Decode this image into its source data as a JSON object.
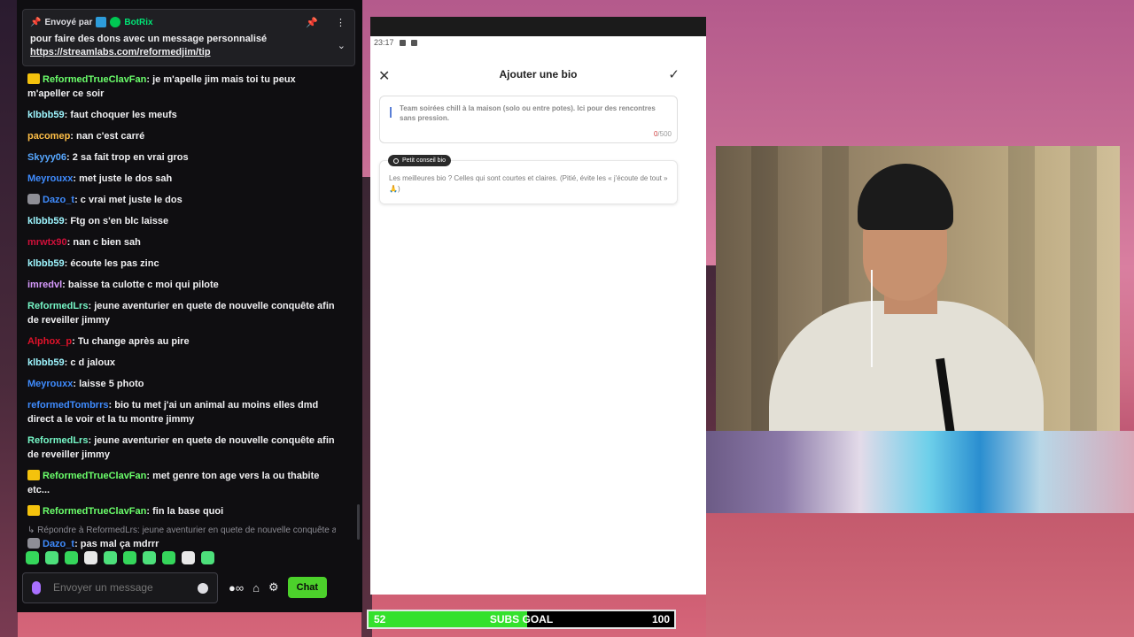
{
  "chat": {
    "pinned": {
      "sent_by_label": "Envoyé par",
      "bot_name": "BotRix",
      "message_line1": "pour faire des dons avec un message personnalisé",
      "message_link": "https://streamlabs.com/reformedjim/tip"
    },
    "messages": [
      {
        "user": "ReformedTrueClavFan",
        "color": "#6bff6b",
        "text": "je m'apelle jim mais toi tu peux m'apeller ce soir",
        "badge": "crown"
      },
      {
        "user": "klbbb59",
        "color": "#9ef6ff",
        "text": "faut choquer les meufs",
        "badge": ""
      },
      {
        "user": "pacomep",
        "color": "#ffbf47",
        "text": "nan c'est carré",
        "badge": ""
      },
      {
        "user": "Skyyy06",
        "color": "#57a7ff",
        "text": "2 sa fait trop en vrai gros",
        "badge": ""
      },
      {
        "user": "Meyrouxx",
        "color": "#3f8cff",
        "text": "met juste le dos sah",
        "badge": ""
      },
      {
        "user": "Dazo_t",
        "color": "#3f8cff",
        "text": "c vrai met juste le dos",
        "badge": "avatar"
      },
      {
        "user": "klbbb59",
        "color": "#9ef6ff",
        "text": "Ftg on s'en blc laisse",
        "badge": ""
      },
      {
        "user": "mrwtx90",
        "color": "#d0103a",
        "text": "nan c bien sah",
        "badge": ""
      },
      {
        "user": "klbbb59",
        "color": "#9ef6ff",
        "text": "écoute les pas zinc",
        "badge": ""
      },
      {
        "user": "imredvl",
        "color": "#d89bff",
        "text": "baisse ta culotte c moi qui pilote",
        "badge": ""
      },
      {
        "user": "ReformedLrs",
        "color": "#76f7c7",
        "text": "jeune aventurier en quete de nouvelle conquête afin de reveiller jimmy",
        "badge": ""
      },
      {
        "user": "Alphox_p",
        "color": "#e0122a",
        "text": "Tu change après au pire",
        "badge": ""
      },
      {
        "user": "klbbb59",
        "color": "#9ef6ff",
        "text": "c d jaloux",
        "badge": ""
      },
      {
        "user": "Meyrouxx",
        "color": "#3f8cff",
        "text": "laisse 5 photo",
        "badge": ""
      },
      {
        "user": "reformedTombrrs",
        "color": "#3f8cff",
        "text": "bio tu met j'ai un animal au moins elles dmd direct a le voir et la tu montre jimmy",
        "badge": ""
      },
      {
        "user": "ReformedLrs",
        "color": "#76f7c7",
        "text": "jeune aventurier en quete de nouvelle conquête afin de reveiller jimmy",
        "badge": ""
      },
      {
        "user": "ReformedTrueClavFan",
        "color": "#6bff6b",
        "text": "met genre ton age vers la ou thabite etc...",
        "badge": "crown"
      },
      {
        "user": "ReformedTrueClavFan",
        "color": "#6bff6b",
        "text": "fin la base quoi",
        "badge": "crown"
      }
    ],
    "reply_line": "Répondre à ReformedLrs: jeune aventurier en quete de nouvelle conquête a...",
    "last_message": {
      "user": "Dazo_t",
      "color": "#3f8cff",
      "text": "pas mal ça mdrrr"
    },
    "input_placeholder": "Envoyer un message",
    "chat_button": "Chat"
  },
  "phone": {
    "status_time": "23:17",
    "title": "Ajouter une bio",
    "bio_placeholder": "Team soirées chill à la maison (solo ou entre potes). Ici pour des rencontres sans pression.",
    "counter_current": "0",
    "counter_max": "/500",
    "tip_label": "Petit conseil bio",
    "tip_text": "Les meilleures bio ? Celles qui sont courtes et claires. (Pitié, évite les « j'écoute de tout » 🙏)"
  },
  "subs_goal": {
    "current": "52",
    "label": "SUBS GOAL",
    "target": "100",
    "progress": 0.52
  }
}
